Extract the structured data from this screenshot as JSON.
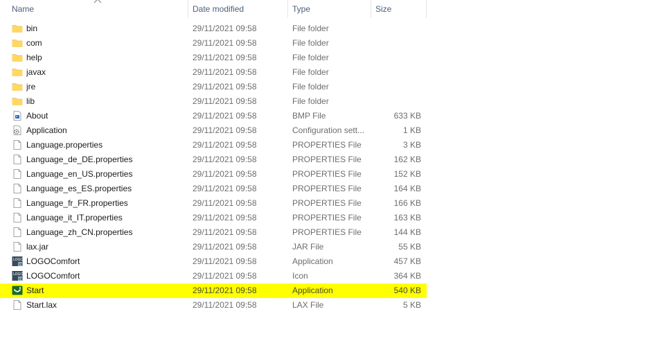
{
  "columns": {
    "name": "Name",
    "date_modified": "Date modified",
    "type": "Type",
    "size": "Size"
  },
  "sort": {
    "column": "name",
    "direction": "ascending",
    "icon": "chevron-up-icon"
  },
  "highlight_color": "#ffff00",
  "files": [
    {
      "name": "bin",
      "date": "29/11/2021 09:58",
      "type": "File folder",
      "size": "",
      "icon": "folder-icon"
    },
    {
      "name": "com",
      "date": "29/11/2021 09:58",
      "type": "File folder",
      "size": "",
      "icon": "folder-icon"
    },
    {
      "name": "help",
      "date": "29/11/2021 09:58",
      "type": "File folder",
      "size": "",
      "icon": "folder-icon"
    },
    {
      "name": "javax",
      "date": "29/11/2021 09:58",
      "type": "File folder",
      "size": "",
      "icon": "folder-icon"
    },
    {
      "name": "jre",
      "date": "29/11/2021 09:58",
      "type": "File folder",
      "size": "",
      "icon": "folder-icon"
    },
    {
      "name": "lib",
      "date": "29/11/2021 09:58",
      "type": "File folder",
      "size": "",
      "icon": "folder-icon"
    },
    {
      "name": "About",
      "date": "29/11/2021 09:58",
      "type": "BMP File",
      "size": "633 KB",
      "icon": "bmp-image-icon"
    },
    {
      "name": "Application",
      "date": "29/11/2021 09:58",
      "type": "Configuration sett...",
      "size": "1 KB",
      "icon": "config-file-icon"
    },
    {
      "name": "Language.properties",
      "date": "29/11/2021 09:58",
      "type": "PROPERTIES File",
      "size": "3 KB",
      "icon": "document-icon"
    },
    {
      "name": "Language_de_DE.properties",
      "date": "29/11/2021 09:58",
      "type": "PROPERTIES File",
      "size": "162 KB",
      "icon": "document-icon"
    },
    {
      "name": "Language_en_US.properties",
      "date": "29/11/2021 09:58",
      "type": "PROPERTIES File",
      "size": "152 KB",
      "icon": "document-icon"
    },
    {
      "name": "Language_es_ES.properties",
      "date": "29/11/2021 09:58",
      "type": "PROPERTIES File",
      "size": "164 KB",
      "icon": "document-icon"
    },
    {
      "name": "Language_fr_FR.properties",
      "date": "29/11/2021 09:58",
      "type": "PROPERTIES File",
      "size": "166 KB",
      "icon": "document-icon"
    },
    {
      "name": "Language_it_IT.properties",
      "date": "29/11/2021 09:58",
      "type": "PROPERTIES File",
      "size": "163 KB",
      "icon": "document-icon"
    },
    {
      "name": "Language_zh_CN.properties",
      "date": "29/11/2021 09:58",
      "type": "PROPERTIES File",
      "size": "144 KB",
      "icon": "document-icon"
    },
    {
      "name": "lax.jar",
      "date": "29/11/2021 09:58",
      "type": "JAR File",
      "size": "55 KB",
      "icon": "document-icon"
    },
    {
      "name": "LOGOComfort",
      "date": "29/11/2021 09:58",
      "type": "Application",
      "size": "457 KB",
      "icon": "logo-app-icon"
    },
    {
      "name": "LOGOComfort",
      "date": "29/11/2021 09:58",
      "type": "Icon",
      "size": "364 KB",
      "icon": "logo-app-icon"
    },
    {
      "name": "Start",
      "date": "29/11/2021 09:58",
      "type": "Application",
      "size": "540 KB",
      "icon": "start-app-icon",
      "highlighted": true
    },
    {
      "name": "Start.lax",
      "date": "29/11/2021 09:58",
      "type": "LAX File",
      "size": "5 KB",
      "icon": "document-icon"
    }
  ]
}
